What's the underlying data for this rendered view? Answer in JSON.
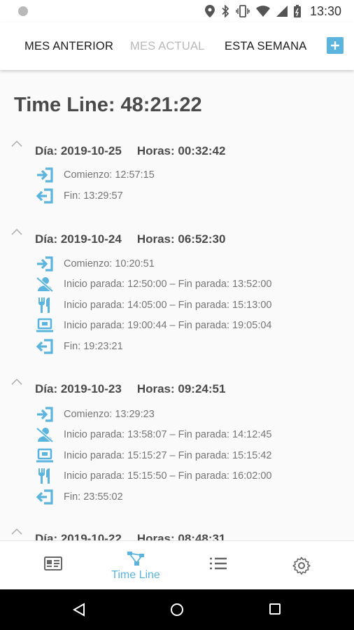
{
  "status_bar": {
    "time": "13:30"
  },
  "top_tabs": {
    "previous_month": "MES ANTERIOR",
    "current_month": "MES ACTUAL",
    "this_week": "ESTA SEMANA"
  },
  "colors": {
    "accent": "#5ab4dd",
    "text_dark": "#4a4a4a",
    "text_muted": "#757575",
    "inactive_tab": "#b8b8b8"
  },
  "timeline": {
    "title": "Time Line: 48:21:22",
    "days": [
      {
        "date": "Día: 2019-10-25",
        "hours": "Horas: 00:32:42",
        "entries": [
          {
            "icon": "login-icon",
            "text": "Comienzo: 12:57:15"
          },
          {
            "icon": "logout-icon",
            "text": "Fin: 13:29:57"
          }
        ]
      },
      {
        "date": "Día: 2019-10-24",
        "hours": "Horas: 06:52:30",
        "entries": [
          {
            "icon": "login-icon",
            "text": "Comienzo: 10:20:51"
          },
          {
            "icon": "person-off-icon",
            "text": "Inicio parada: 12:50:00 – Fin parada: 13:52:00"
          },
          {
            "icon": "restaurant-icon",
            "text": "Inicio parada: 14:05:00 – Fin parada: 15:13:00"
          },
          {
            "icon": "laptop-icon",
            "text": "Inicio parada: 19:00:44 – Fin parada: 19:05:04"
          },
          {
            "icon": "logout-icon",
            "text": "Fin: 19:23:21"
          }
        ]
      },
      {
        "date": "Día: 2019-10-23",
        "hours": "Horas: 09:24:51",
        "entries": [
          {
            "icon": "login-icon",
            "text": "Comienzo: 13:29:23"
          },
          {
            "icon": "person-off-icon",
            "text": "Inicio parada: 13:58:07 – Fin parada: 14:12:45"
          },
          {
            "icon": "laptop-icon",
            "text": "Inicio parada: 15:15:27 – Fin parada: 15:15:42"
          },
          {
            "icon": "restaurant-icon",
            "text": "Inicio parada: 15:15:50 – Fin parada: 16:02:00"
          },
          {
            "icon": "logout-icon",
            "text": "Fin: 23:55:02"
          }
        ]
      },
      {
        "date": "Día: 2019-10-22",
        "hours": "Horas: 08:48:31",
        "entries": []
      }
    ]
  },
  "bottom_nav": {
    "items": [
      {
        "icon": "id-card-icon",
        "label": ""
      },
      {
        "icon": "timeline-icon",
        "label": "Time Line"
      },
      {
        "icon": "list-icon",
        "label": ""
      },
      {
        "icon": "settings-icon",
        "label": ""
      }
    ]
  }
}
